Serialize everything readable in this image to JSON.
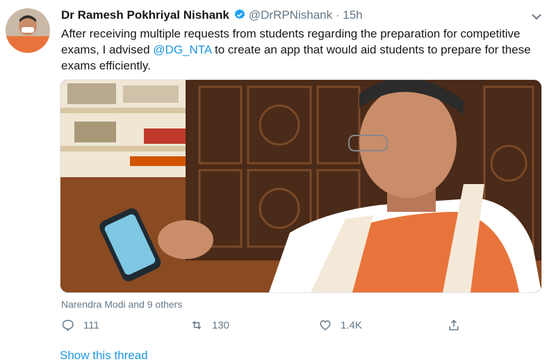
{
  "author": {
    "name": "Dr Ramesh Pokhriyal Nishank",
    "handle": "@DrRPNishank",
    "separator": "·",
    "time": "15h"
  },
  "tweet": {
    "text_before": "After receiving multiple requests from students regarding the preparation for competitive exams, I advised ",
    "mention": "@DG_NTA",
    "text_after": " to create an app that would aid students to prepare for these exams efficiently."
  },
  "likes_summary": "Narendra Modi and 9 others",
  "actions": {
    "reply_count": "111",
    "retweet_count": "130",
    "like_count": "1.4K"
  },
  "thread_link": "Show this thread",
  "colors": {
    "accent": "#1b95e0",
    "muted": "#657786",
    "text": "#14171a"
  },
  "icons": [
    "verified-badge-icon",
    "chevron-down-icon",
    "reply-icon",
    "retweet-icon",
    "like-icon",
    "share-icon"
  ]
}
